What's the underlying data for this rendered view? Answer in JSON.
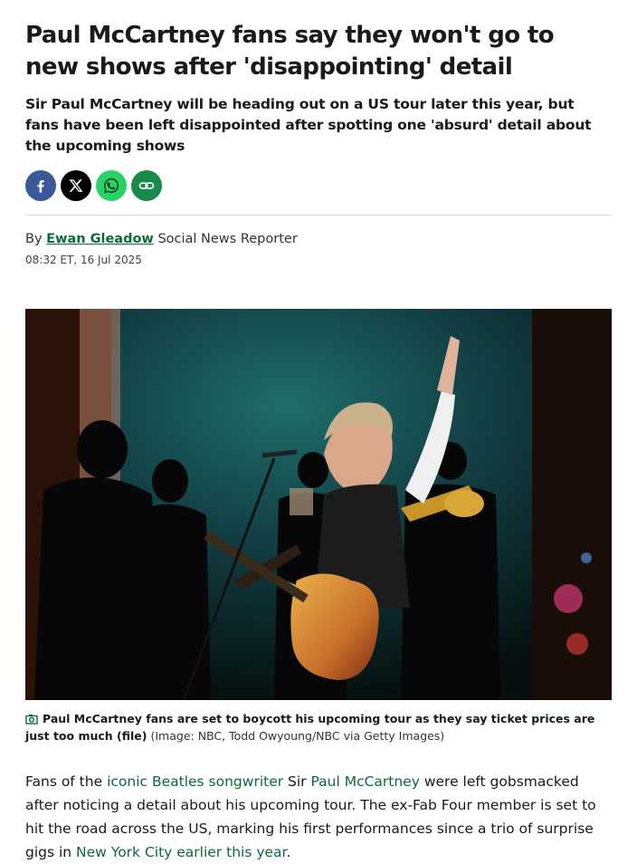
{
  "article": {
    "headline": "Paul McCartney fans say they won't go to new shows after 'disappointing' detail",
    "standfirst": "Sir Paul McCartney will be heading out on a US tour later this year, but fans have been left disappointed after spotting one 'absurd' detail about the upcoming shows",
    "byline_prefix": "By",
    "author": "Ewan Gleadow",
    "author_role": "Social News Reporter",
    "timestamp": "08:32 ET, 16 Jul 2025"
  },
  "share": {
    "icons": [
      "facebook-icon",
      "x-icon",
      "whatsapp-icon",
      "link-icon"
    ],
    "colors": {
      "facebook": "#3b5998",
      "x": "#000000",
      "whatsapp": "#25d366",
      "link": "#1a8a4a"
    }
  },
  "image": {
    "caption": "Paul McCartney fans are set to boycott his upcoming tour as they say ticket prices are just too much (file)",
    "credit": "(Image: NBC, Todd Owyoung/NBC via Getty Images)"
  },
  "body": {
    "p1_a": "Fans of the ",
    "p1_link1": "iconic Beatles songwriter",
    "p1_b": " Sir ",
    "p1_link2": "Paul McCartney",
    "p1_c": " were left gobsmacked after noticing a detail about his upcoming tour. The ex-Fab Four member is set to hit the road across the US, marking his first performances since a trio of surprise gigs in ",
    "p1_link3": "New York City earlier this year",
    "p1_d": "."
  },
  "theme": {
    "link_green": "#0b6b3a"
  }
}
